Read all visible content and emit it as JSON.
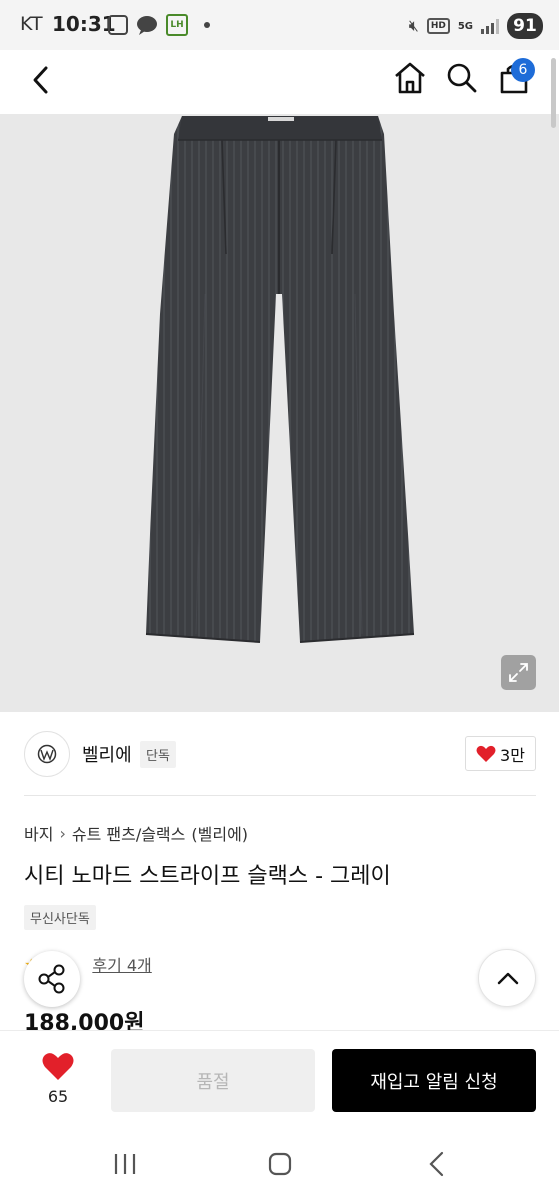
{
  "status_bar": {
    "carrier": "KT",
    "time": "10:31",
    "lh_label": "LH",
    "hd_label": "HD",
    "network": "5G",
    "battery": "91"
  },
  "header": {
    "cart_count": "6",
    "icons": [
      "back-icon",
      "home-icon",
      "search-icon",
      "cart-icon"
    ]
  },
  "brand": {
    "name": "벨리에",
    "exclusive_tag": "단독",
    "likes": "3만"
  },
  "breadcrumb": {
    "category": "바지",
    "subcategory": "슈트 팬츠/슬랙스",
    "brand": "(벨리에)"
  },
  "product": {
    "title": "시티 노마드 스트라이프 슬랙스 - 그레이",
    "store_tag": "무신사단독",
    "review_link": "후기 4개",
    "price": "188,000원"
  },
  "action_bar": {
    "wish_count": "65",
    "soldout_label": "품절",
    "restock_label": "재입고 알림 신청"
  },
  "colors": {
    "accent_blue": "#1e6cd8",
    "heart_red": "#e2202a",
    "star_yellow": "#f3b319"
  }
}
